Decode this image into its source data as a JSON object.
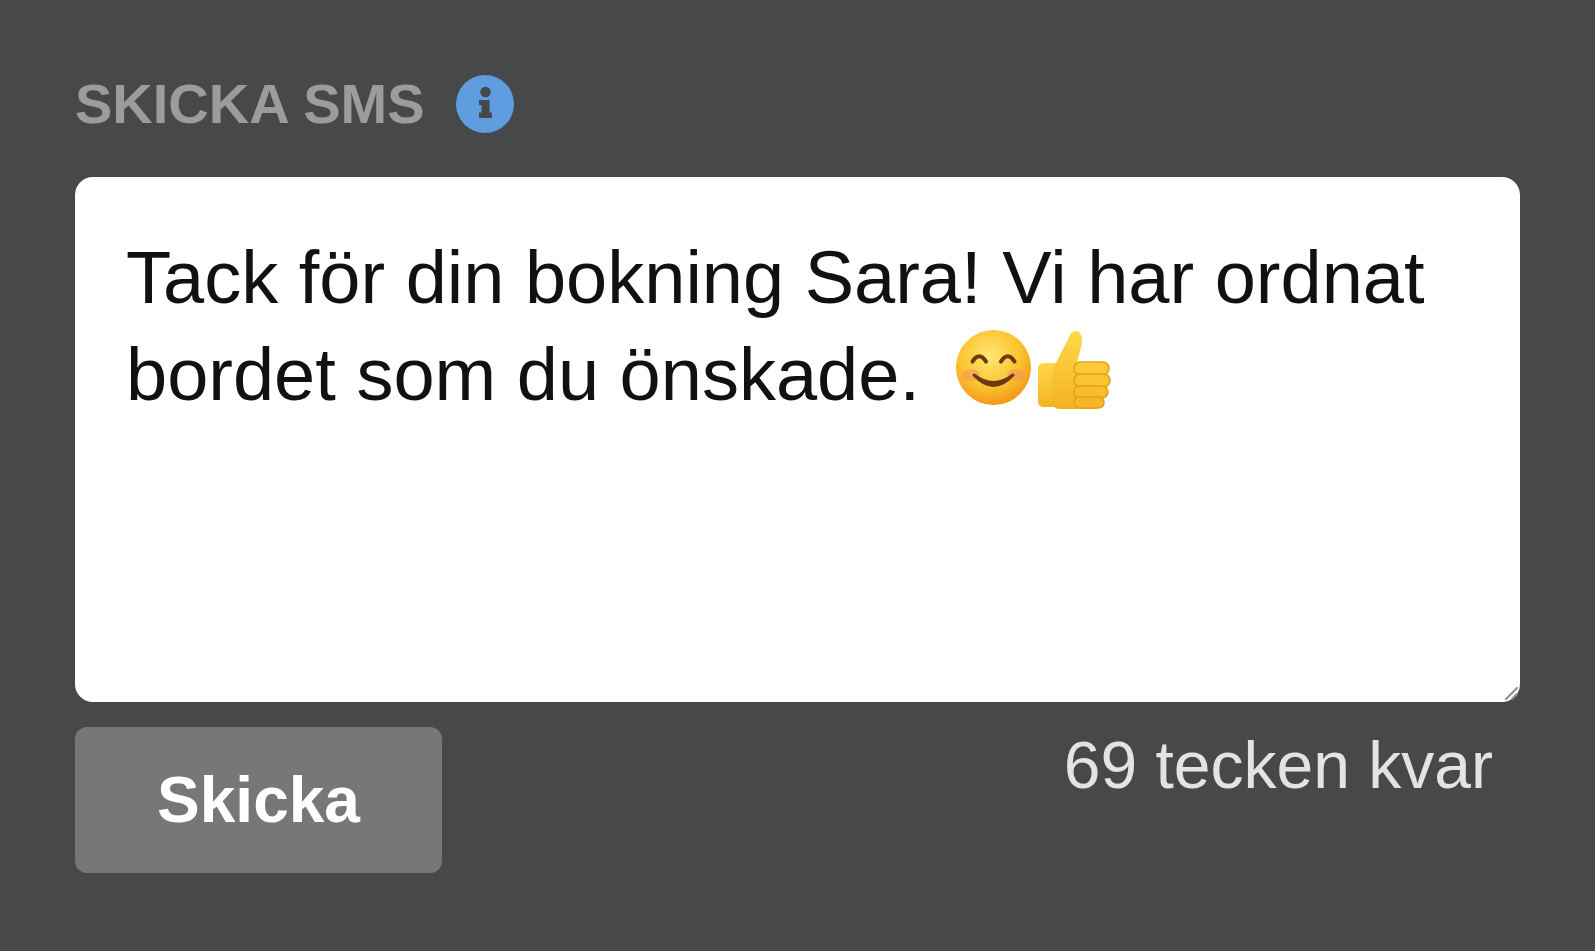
{
  "panel": {
    "title": "SKICKA SMS"
  },
  "message": {
    "value": "Tack för din bokning Sara! Vi har ordnat bordet som du önskade."
  },
  "send_button": {
    "label": "Skicka"
  },
  "counter": {
    "text": "69 tecken kvar"
  }
}
